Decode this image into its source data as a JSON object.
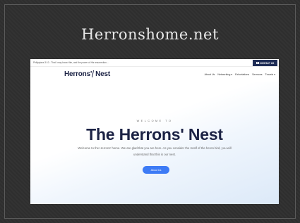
{
  "slide": {
    "title": "Herronshome.net"
  },
  "site": {
    "topbar": {
      "verse": "Philippians 3:10 - That I may know Him, and the power of His resurrection...",
      "contact_label": "CONTACT US"
    },
    "logo": {
      "text_left": "Herrons'",
      "text_right": "Nest"
    },
    "nav": {
      "items": [
        {
          "label": "About Us"
        },
        {
          "label": "Networking",
          "dropdown": true
        },
        {
          "label": "Exhortations"
        },
        {
          "label": "Sermons"
        },
        {
          "label": "Travels",
          "dropdown": true
        }
      ],
      "chevron": "▾"
    },
    "hero": {
      "welcome": "WELCOME TO",
      "headline": "The Herrons' Nest",
      "description": "Welcome to the Herrons' home. We are glad that you are here. As you consider the motif of the heron bird, you will understand that this is our nest.",
      "button_label": "About Us"
    }
  }
}
